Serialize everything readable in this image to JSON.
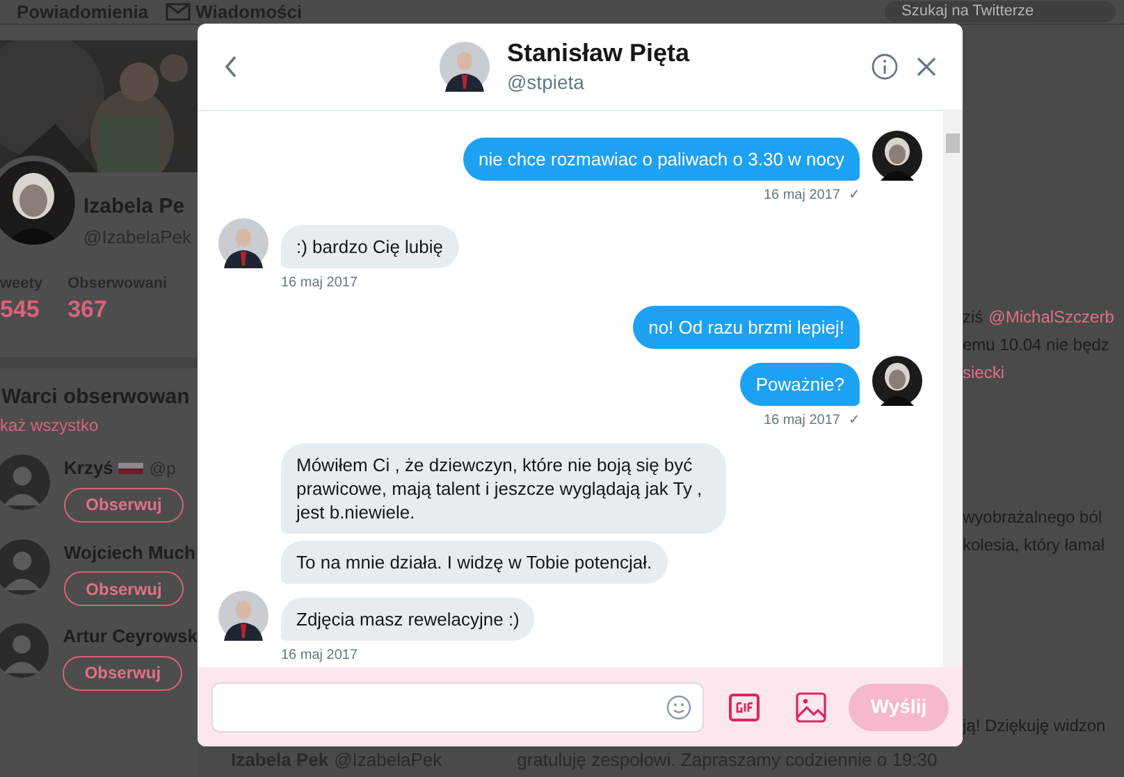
{
  "background": {
    "nav": [
      {
        "label": "Powiadomienia"
      },
      {
        "label": "Wiadomości"
      }
    ],
    "search": {
      "placeholder": "Szukaj na Twitterze"
    },
    "profile": {
      "name": "Izabela Pe",
      "handle": "@IzabelaPek",
      "stats": [
        {
          "label": "weety",
          "value": "545"
        },
        {
          "label": "Obserwowani",
          "value": "367"
        }
      ]
    },
    "suggestions": {
      "title": "Warci obserwowan",
      "link": "każ wszystko",
      "people": [
        {
          "name": "Krzyś",
          "flag": true,
          "handle": "@p",
          "button": "Obserwuj"
        },
        {
          "name": "Wojciech Much",
          "flag": false,
          "button": "Obserwuj"
        },
        {
          "name": "Artur Ceyrowsk",
          "flag": false,
          "button": "Obserwuj"
        }
      ]
    },
    "timeline": [
      {
        "parts": [
          {
            "text": "ziś",
            "link": false
          },
          {
            "text": "@MichalSzczerb",
            "link": true
          }
        ]
      },
      {
        "parts": [
          {
            "text": "emu 10.04 nie będz",
            "link": false
          }
        ]
      },
      {
        "parts": [
          {
            "text": "siecki",
            "link": true
          }
        ]
      },
      {
        "parts": [
          {
            "text": "wyobrażalnego ból",
            "link": false
          }
        ]
      },
      {
        "parts": [
          {
            "text": "kolesia, który łamał",
            "link": false
          }
        ]
      },
      {
        "parts": [
          {
            "text": "ją! Dziękuję widzon",
            "link": false
          }
        ]
      }
    ],
    "bottom_tweet": {
      "name": "Izabela Pek",
      "handle": "@IzabelaPek",
      "text": "gratuluję zespołowi. Zapraszamy codziennie o 19:30"
    }
  },
  "conversation": {
    "name": "Stanisław Pięta",
    "handle": "@stpieta",
    "groups": [
      {
        "kind": "sent",
        "bubbles": [
          "nie chce rozmawiac o paliwach o 3.30 w nocy"
        ],
        "time": "16 maj 2017",
        "check": "✓"
      },
      {
        "kind": "received",
        "bubbles": [
          ":) bardzo Cię lubię"
        ],
        "time": "16 maj 2017"
      },
      {
        "kind": "sent",
        "bubbles": [
          "no! Od razu brzmi lepiej!",
          "Poważnie?"
        ],
        "time": "16 maj 2017",
        "check": "✓"
      },
      {
        "kind": "received",
        "bubbles": [
          "Mówiłem Ci , że dziewczyn, które nie boją się być prawicowe, mają talent i jeszcze wyglądają jak Ty , jest b.niewiele.",
          "To na mnie działa. I widzę w Tobie potencjał.",
          "Zdjęcia masz rewelacyjne :)"
        ],
        "time": "16 maj 2017"
      }
    ],
    "composer": {
      "send": "Wyślij",
      "send_disabled": true
    }
  }
}
